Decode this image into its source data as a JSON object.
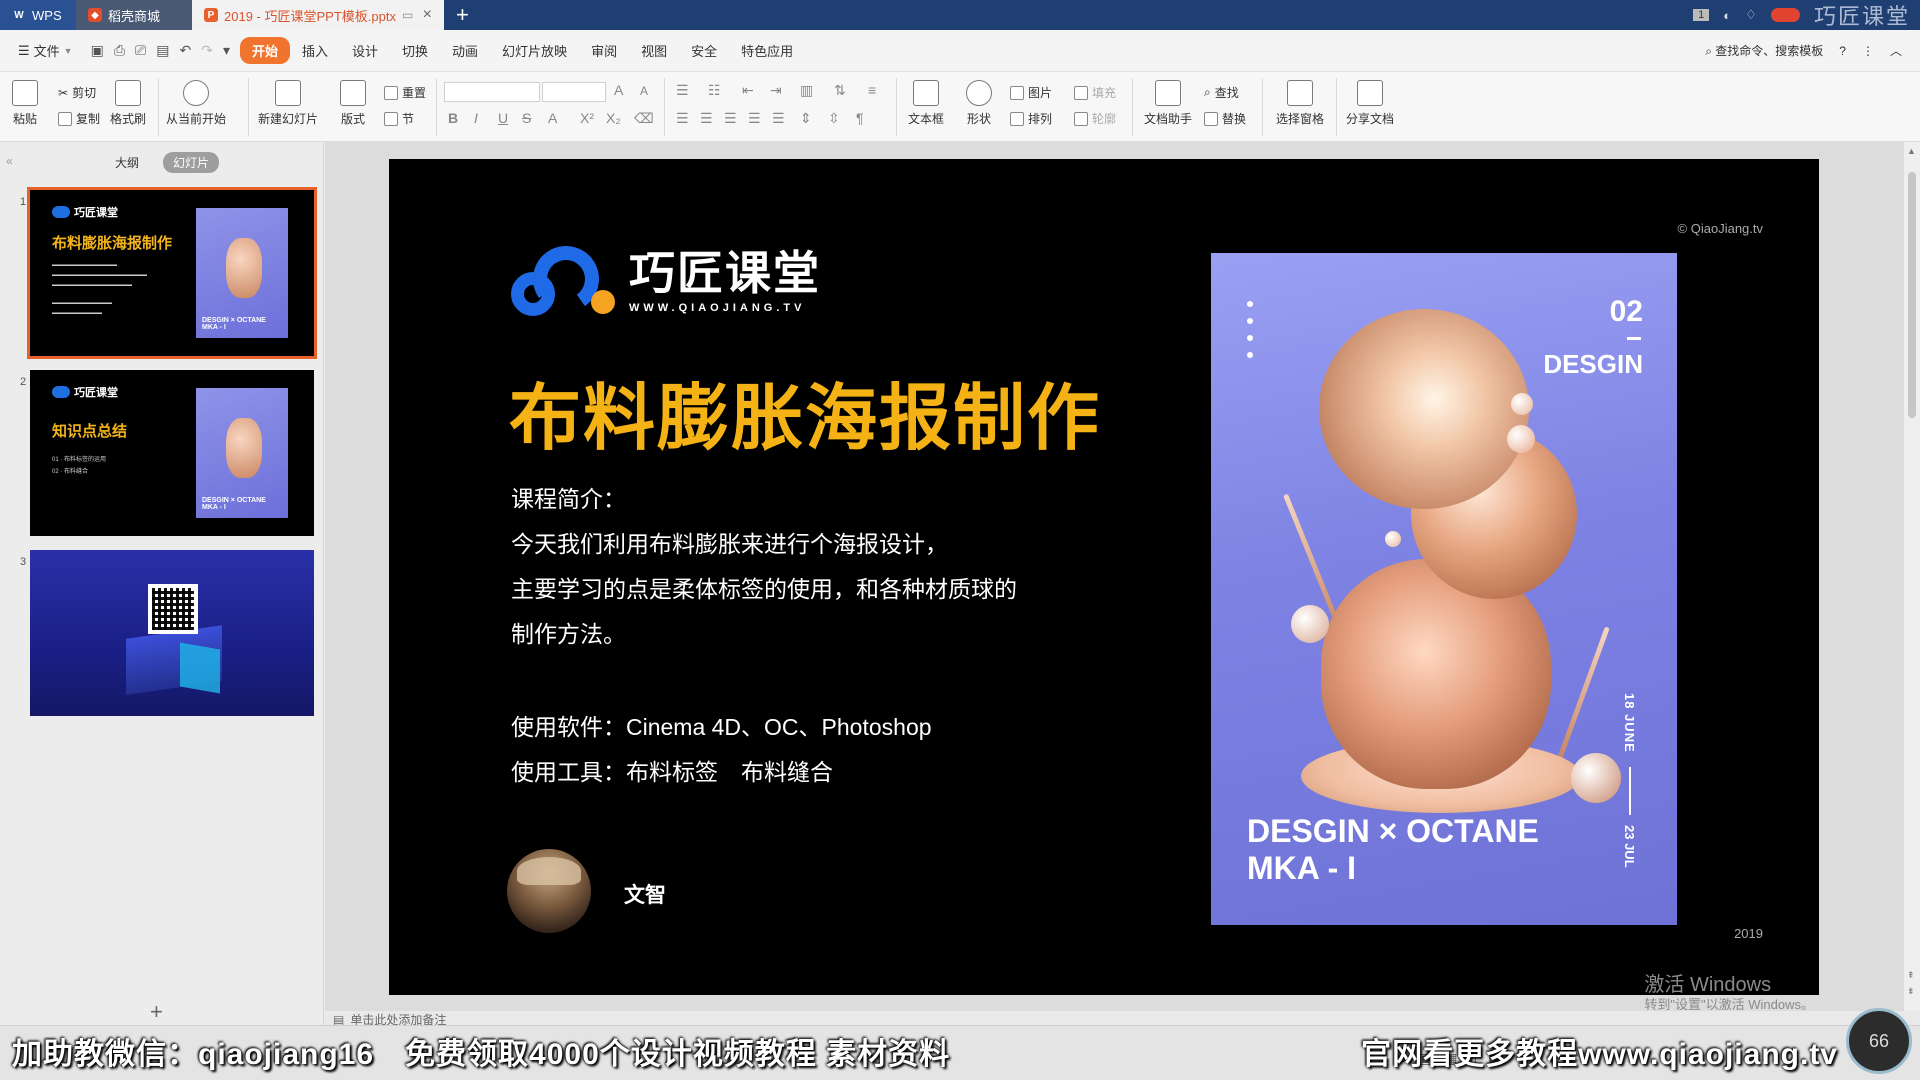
{
  "titlebar": {
    "tabs": [
      {
        "label": "WPS",
        "icon": "wps-logo-icon"
      },
      {
        "label": "稻壳商城",
        "icon": "docer-icon"
      },
      {
        "label": "2019 - 巧匠课堂PPT模板.pptx",
        "icon": "ppt-file-icon"
      }
    ],
    "new_tab": "+",
    "page_badge": "1",
    "watermark": "巧匠课堂"
  },
  "menubar": {
    "file": "文件",
    "items": [
      "开始",
      "插入",
      "设计",
      "切换",
      "动画",
      "幻灯片放映",
      "审阅",
      "视图",
      "安全",
      "特色应用"
    ],
    "active": "开始",
    "search": "查找命令、搜索模板",
    "help": "?"
  },
  "ribbon": {
    "paste": "粘贴",
    "cut": "剪切",
    "copy": "复制",
    "format_painter": "格式刷",
    "from_current": "从当前开始",
    "new_slide": "新建幻灯片",
    "layout": "版式",
    "reset": "重置",
    "section": "节",
    "textbox": "文本框",
    "shape": "形状",
    "picture": "图片",
    "fill": "填充",
    "arrange": "排列",
    "outline": "轮廓",
    "doc_assistant": "文档助手",
    "find": "查找",
    "replace": "替换",
    "select_pane": "选择窗格",
    "share_doc": "分享文档"
  },
  "left_panel": {
    "tabs": [
      "大纲",
      "幻灯片"
    ],
    "active_tab": "幻灯片",
    "slides": [
      {
        "num": "1",
        "logo": "巧匠课堂",
        "title": "布料膨胀海报制作"
      },
      {
        "num": "2",
        "logo": "巧匠课堂",
        "title": "知识点总结",
        "lines": [
          "01 · 布料标签的运用",
          "02 · 布料缝合"
        ]
      },
      {
        "num": "3"
      }
    ]
  },
  "slide": {
    "copyright": "© QiaoJiang.tv",
    "logo_cn": "巧匠课堂",
    "logo_url": "WWW.QIAOJIANG.TV",
    "title": "布料膨胀海报制作",
    "intro_heading": "课程简介：",
    "intro_lines": [
      "今天我们利用布料膨胀来进行个海报设计，",
      "主要学习的点是柔体标签的使用，和各种材质球的",
      "制作方法。"
    ],
    "software": "使用软件：Cinema 4D、OC、Photoshop",
    "tools": "使用工具：布料标签　布料缝合",
    "author": "文智",
    "year": "2019",
    "poster": {
      "number": "02",
      "design": "DESGIN",
      "date_top": "18 JUNE",
      "date_bottom": "23 JUL",
      "bottom_line1": "DESGIN × OCTANE",
      "bottom_line2": "MKA - I"
    }
  },
  "windows_notice": {
    "line1": "激活 Windows",
    "line2": "转到\"设置\"以激活 Windows。"
  },
  "notes": {
    "hint": "单击此处添加备注"
  },
  "banner": {
    "left": "加助教微信：qiaojiang16　免费领取4000个设计视频教程 素材资料",
    "right": "官网看更多教程www.qiaojiang.tv"
  },
  "zoom": "66"
}
